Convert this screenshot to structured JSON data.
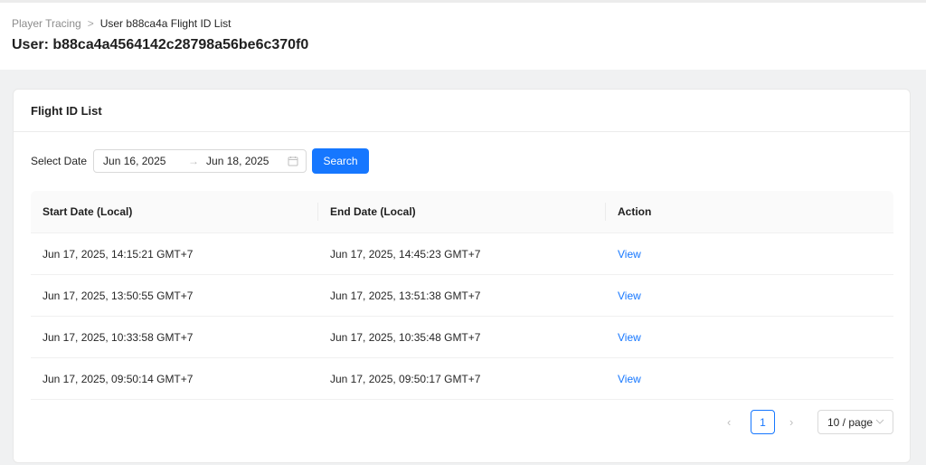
{
  "breadcrumb": {
    "parent": "Player Tracing",
    "separator": ">",
    "current": "User b88ca4a Flight ID List"
  },
  "page_title": "User: b88ca4a4564142c28798a56be6c370f0",
  "card": {
    "title": "Flight ID List",
    "filter": {
      "label": "Select Date",
      "start_date": "Jun 16, 2025",
      "arrow": "→",
      "end_date": "Jun 18, 2025",
      "search_label": "Search"
    },
    "table": {
      "headers": [
        "Start Date (Local)",
        "End Date (Local)",
        "Action"
      ],
      "rows": [
        {
          "start": "Jun 17, 2025, 14:15:21 GMT+7",
          "end": "Jun 17, 2025, 14:45:23 GMT+7",
          "action": "View"
        },
        {
          "start": "Jun 17, 2025, 13:50:55 GMT+7",
          "end": "Jun 17, 2025, 13:51:38 GMT+7",
          "action": "View"
        },
        {
          "start": "Jun 17, 2025, 10:33:58 GMT+7",
          "end": "Jun 17, 2025, 10:35:48 GMT+7",
          "action": "View"
        },
        {
          "start": "Jun 17, 2025, 09:50:14 GMT+7",
          "end": "Jun 17, 2025, 09:50:17 GMT+7",
          "action": "View"
        }
      ]
    },
    "pagination": {
      "prev": "‹",
      "current_page": "1",
      "next": "›",
      "page_size": "10 / page"
    }
  },
  "colors": {
    "accent": "#1677ff",
    "background": "#f0f1f2"
  },
  "icons": {
    "calendar": "calendar-icon",
    "chevron": "chevron-down-icon"
  }
}
